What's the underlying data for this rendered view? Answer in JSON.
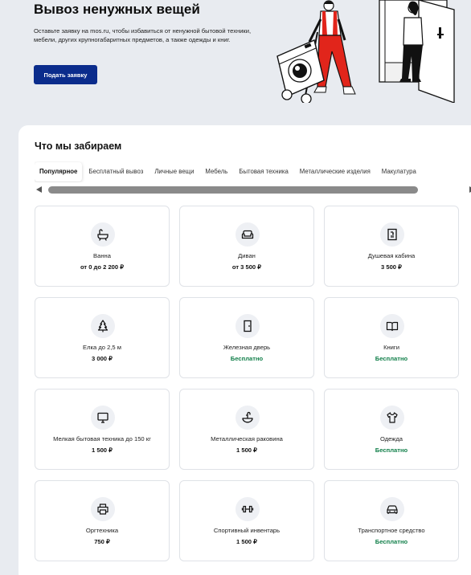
{
  "hero": {
    "title": "Вывоз ненужных вещей",
    "description": "Оставьте заявку на mos.ru, чтобы избавиться от ненужной бытовой техники, мебели, других крупногабаритных предметов, а также одежды и книг.",
    "cta_label": "Подать заявку"
  },
  "section": {
    "title": "Что мы забираем"
  },
  "tabs": [
    {
      "label": "Популярное",
      "active": true
    },
    {
      "label": "Бесплатный вывоз",
      "active": false
    },
    {
      "label": "Личные вещи",
      "active": false
    },
    {
      "label": "Мебель",
      "active": false
    },
    {
      "label": "Бытовая техника",
      "active": false
    },
    {
      "label": "Металлические изделия",
      "active": false
    },
    {
      "label": "Макулатура",
      "active": false
    }
  ],
  "colors": {
    "accent": "#0b2c8c",
    "free": "#13804b",
    "background": "#e8ebf0"
  },
  "items": [
    {
      "name": "Ванна",
      "price": "от 0 до 2 200 ₽",
      "free": false,
      "icon": "bathtub-icon"
    },
    {
      "name": "Диван",
      "price": "от 3 500 ₽",
      "free": false,
      "icon": "sofa-icon"
    },
    {
      "name": "Душевая кабина",
      "price": "3 500 ₽",
      "free": false,
      "icon": "shower-cabin-icon"
    },
    {
      "name": "Елка до 2,5 м",
      "price": "3 000 ₽",
      "free": false,
      "icon": "fir-tree-icon"
    },
    {
      "name": "Железная дверь",
      "price": "Бесплатно",
      "free": true,
      "icon": "door-icon"
    },
    {
      "name": "Книги",
      "price": "Бесплатно",
      "free": true,
      "icon": "book-icon"
    },
    {
      "name": "Мелкая бытовая техника до 150 кг",
      "price": "1 500 ₽",
      "free": false,
      "icon": "monitor-icon"
    },
    {
      "name": "Металлическая раковина",
      "price": "1 500 ₽",
      "free": false,
      "icon": "sink-icon"
    },
    {
      "name": "Одежда",
      "price": "Бесплатно",
      "free": true,
      "icon": "tshirt-icon"
    },
    {
      "name": "Оргтехника",
      "price": "750 ₽",
      "free": false,
      "icon": "printer-icon"
    },
    {
      "name": "Спортивный инвентарь",
      "price": "1 500 ₽",
      "free": false,
      "icon": "dumbbell-icon"
    },
    {
      "name": "Транспортное средство",
      "price": "Бесплатно",
      "free": true,
      "icon": "car-icon"
    }
  ]
}
